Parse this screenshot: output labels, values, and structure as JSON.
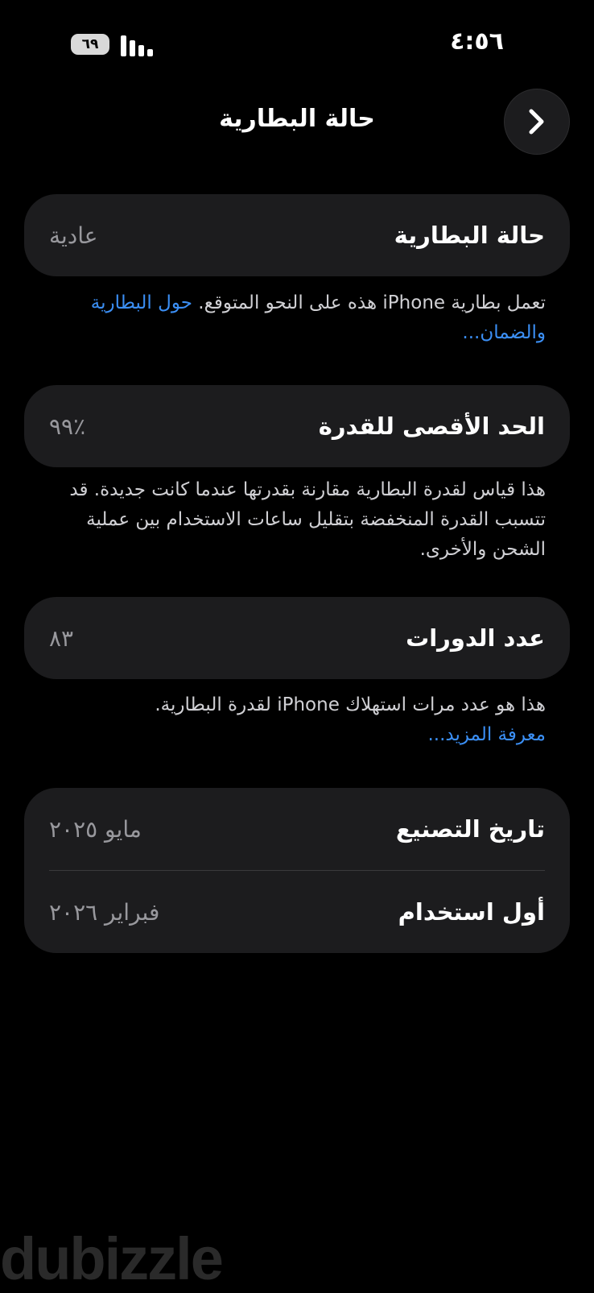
{
  "status_bar": {
    "time": "٤:٥٦",
    "battery_level": "٦٩"
  },
  "nav": {
    "title": "حالة البطارية"
  },
  "battery_health": {
    "label": "حالة البطارية",
    "value": "عادية",
    "note": "تعمل بطارية iPhone هذه على النحو المتوقع.",
    "link": "حول البطارية والضمان..."
  },
  "max_capacity": {
    "label": "الحد الأقصى للقدرة",
    "value": "٪٩٩",
    "note": "هذا قياس لقدرة البطارية مقارنة بقدرتها عندما كانت جديدة. قد تتسبب القدرة المنخفضة بتقليل ساعات الاستخدام بين عملية الشحن والأخرى."
  },
  "cycle_count": {
    "label": "عدد الدورات",
    "value": "٨٣",
    "note": "هذا هو عدد مرات استهلاك iPhone لقدرة البطارية.",
    "link": "معرفة المزيد..."
  },
  "dates": {
    "manufacture_label": "تاريخ التصنيع",
    "manufacture_value": "مايو ٢٠٢٥",
    "first_use_label": "أول استخدام",
    "first_use_value": "فبراير ٢٠٢٦"
  },
  "watermark": "dubizzle"
}
